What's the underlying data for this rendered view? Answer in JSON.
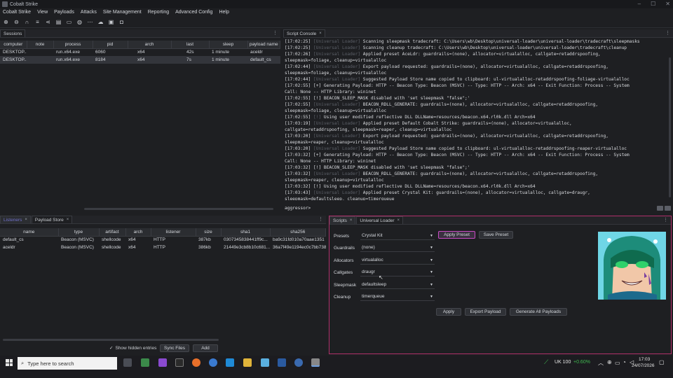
{
  "window": {
    "title": "Cobalt Strike"
  },
  "menu": [
    "Cobalt Strike",
    "View",
    "Payloads",
    "Attacks",
    "Site Management",
    "Reporting",
    "Advanced Config",
    "Help"
  ],
  "sessions": {
    "tab_label": "Sessions",
    "columns": [
      "computer",
      "note",
      "process",
      "pid",
      "arch",
      "last",
      "sleep",
      "payload name"
    ],
    "rows": [
      {
        "computer": "DESKTOP...",
        "note": "",
        "process": "run.x64.exe",
        "pid": "6060",
        "arch": "x64",
        "last": "42s",
        "sleep": "1 minute",
        "payload": "aceldr"
      },
      {
        "computer": "DESKTOP...",
        "note": "",
        "process": "run.x64.exe",
        "pid": "8184",
        "arch": "x64",
        "last": "7s",
        "sleep": "1 minute",
        "payload": "default_cs"
      }
    ]
  },
  "console": {
    "tab_label": "Script Console",
    "lines": [
      [
        "[17:02:25]",
        "[Universal Loader]",
        " Scanning sleepmask tradecraft: C:\\Users\\wb\\Desktop\\universal-loader\\universal-loader\\tradecraft\\sleepmasks"
      ],
      [
        "[17:02:25]",
        "[Universal Loader]",
        " Scanning cleanup tradecraft: C:\\Users\\wb\\Desktop\\universal-loader\\universal-loader\\tradecraft\\cleanup"
      ],
      [
        "[17:02:26]",
        "[Universal Loader]",
        " Applied preset AceLdr: guardrails=(none), allocator=virtualalloc, callgate=retaddrspoofing,\nsleepmask=foliage, cleanup=virtualalloc"
      ],
      [
        "[17:02:44]",
        "[Universal Loader]",
        " Export payload requested: guardrails=(none), allocator=virtualalloc, callgate=retaddrspoofing,\nsleepmask=foliage, cleanup=virtualalloc"
      ],
      [
        "[17:02:44]",
        "[Universal Loader]",
        " Suggested Payload Store name copied to clipboard: ul-virtualalloc-retaddrspoofing-foliage-virtualalloc"
      ],
      [
        "[17:02:55]",
        "",
        " [+] Generating Payload: HTTP -- Beacon Type: Beacon (MSVC) -- Type: HTTP -- Arch: x64 -- Exit Function: Process -- System\nCall: None -- HTTP Library: wininet"
      ],
      [
        "[17:02:55]",
        "",
        " [!] BEACON_SLEEP_MASK disabled with 'set sleepmask \"false\";'"
      ],
      [
        "[17:02:55]",
        "[Universal Loader]",
        " BEACON_RDLL_GENERATE: guardrails=(none), allocator=virtualalloc, callgate=retaddrspoofing,\nsleepmask=foliage, cleanup=virtualalloc"
      ],
      [
        "[17:02:55]",
        "[!]",
        " Using user modified reflective DLL DLLName=resources/beacon.x64.rl0k.dll Arch=x64"
      ],
      [
        "[17:03:19]",
        "[Universal Loader]",
        " Applied preset Default Cobalt Strike: guardrails=(none), allocator=virtualalloc,\ncallgate=retaddrspoofing, sleepmask=reaper, cleanup=virtualalloc"
      ],
      [
        "[17:03:20]",
        "[Universal Loader]",
        " Export payload requested: guardrails=(none), allocator=virtualalloc, callgate=retaddrspoofing,\nsleepmask=reaper, cleanup=virtualalloc"
      ],
      [
        "[17:03:20]",
        "[Universal Loader]",
        " Suggested Payload Store name copied to clipboard: ul-virtualalloc-retaddrspoofing-reaper-virtualalloc"
      ],
      [
        "[17:03:32]",
        "",
        " [+] Generating Payload: HTTP -- Beacon Type: Beacon (MSVC) -- Type: HTTP -- Arch: x64 -- Exit Function: Process -- System\nCall: None -- HTTP Library: wininet"
      ],
      [
        "[17:03:32]",
        "",
        " [!] BEACON_SLEEP_MASK disabled with 'set sleepmask \"false\";'"
      ],
      [
        "[17:03:32]",
        "[Universal Loader]",
        " BEACON_RDLL_GENERATE: guardrails=(none), allocator=virtualalloc, callgate=retaddrspoofing,\nsleepmask=reaper, cleanup=virtualalloc"
      ],
      [
        "[17:03:32]",
        "",
        " [!] Using user modified reflective DLL DLLName=resources/beacon.x64.rl0k.dll Arch=x64"
      ],
      [
        "[17:03:43]",
        "[Universal Loader]",
        " Applied preset Crystal Kit: guardrails=(none), allocator=virtualalloc, callgate=draugr,\nsleepmask=defaultsleep, cleanup=timerqueue"
      ]
    ],
    "prompt": "aggressor>"
  },
  "payload_store": {
    "tabs": [
      "Listeners",
      "Payload Store"
    ],
    "columns": [
      "name",
      "type",
      "artifact",
      "arch",
      "listener",
      "size",
      "sha1",
      "sha256"
    ],
    "rows": [
      {
        "name": "default_cs",
        "type": "Beacon (MSVC)",
        "artifact": "shellcode",
        "arch": "x64",
        "listener": "HTTP",
        "size": "387kb",
        "sha1": "0307345838441ff9c...",
        "sha256": "ba9c31fd010a70aae1351"
      },
      {
        "name": "aceldr",
        "type": "Beacon (MSVC)",
        "artifact": "shellcode",
        "arch": "x64",
        "listener": "HTTP",
        "size": "386kb",
        "sha1": "21449e3cb8b10c681...",
        "sha256": "36a7f49e1194ec0c7bb738"
      }
    ],
    "show_hidden_label": "Show hidden entries",
    "sync_label": "Sync Files",
    "add_label": "Add"
  },
  "loader": {
    "tabs": [
      "Scripts",
      "Universal Loader"
    ],
    "fields": [
      {
        "label": "Presets",
        "value": "Crystal Kit"
      },
      {
        "label": "Guardrails",
        "value": "(none)"
      },
      {
        "label": "Allocators",
        "value": "virtualalloc"
      },
      {
        "label": "Callgates",
        "value": "draugr"
      },
      {
        "label": "Sleepmask",
        "value": "defaultsleep"
      },
      {
        "label": "Cleanup",
        "value": "timerqueue"
      }
    ],
    "apply_preset_label": "Apply Preset",
    "save_preset_label": "Save Preset",
    "apply_label": "Apply",
    "export_label": "Export Payload",
    "generate_all_label": "Generate All Payloads"
  },
  "taskbar": {
    "search_placeholder": "Type here to search",
    "ticker": "UK 100",
    "ticker_change": "+0.60%",
    "time": "17:03",
    "date": "24/07/2026"
  },
  "colors": {
    "accent": "#c94ac4",
    "ticker_up": "#3fb950",
    "panel_border": "#b0306a"
  }
}
